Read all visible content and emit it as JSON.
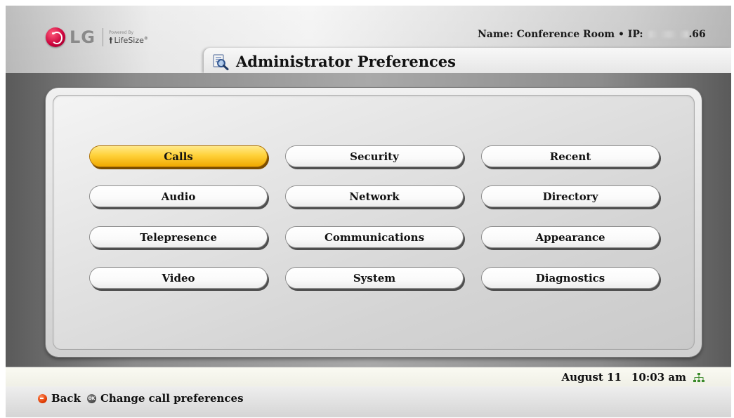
{
  "brand": {
    "lg_text": "LG",
    "powered_by": "Powered By",
    "lifesize_text": "LifeSize",
    "lifesize_mark": "†",
    "registered": "®"
  },
  "header": {
    "name_prefix": "Name: Conference Room • IP: ",
    "ip_suffix": ".66",
    "title": "Administrator Preferences",
    "title_icon": "preferences-magnifier-icon"
  },
  "menu": {
    "items": [
      {
        "label": "Calls",
        "selected": true
      },
      {
        "label": "Security",
        "selected": false
      },
      {
        "label": "Recent",
        "selected": false
      },
      {
        "label": "Audio",
        "selected": false
      },
      {
        "label": "Network",
        "selected": false
      },
      {
        "label": "Directory",
        "selected": false
      },
      {
        "label": "Telepresence",
        "selected": false
      },
      {
        "label": "Communications",
        "selected": false
      },
      {
        "label": "Appearance",
        "selected": false
      },
      {
        "label": "Video",
        "selected": false
      },
      {
        "label": "System",
        "selected": false
      },
      {
        "label": "Diagnostics",
        "selected": false
      }
    ]
  },
  "status": {
    "date": "August 11",
    "time": "10:03 am",
    "network_icon": "network-connected-icon"
  },
  "hints": {
    "back_label": "Back",
    "ok_glyph": "OK",
    "ok_label": "Change call preferences"
  },
  "colors": {
    "selected_button": "#ffd23a",
    "lg_brand": "#c8003a",
    "back_button": "#e03a00"
  }
}
